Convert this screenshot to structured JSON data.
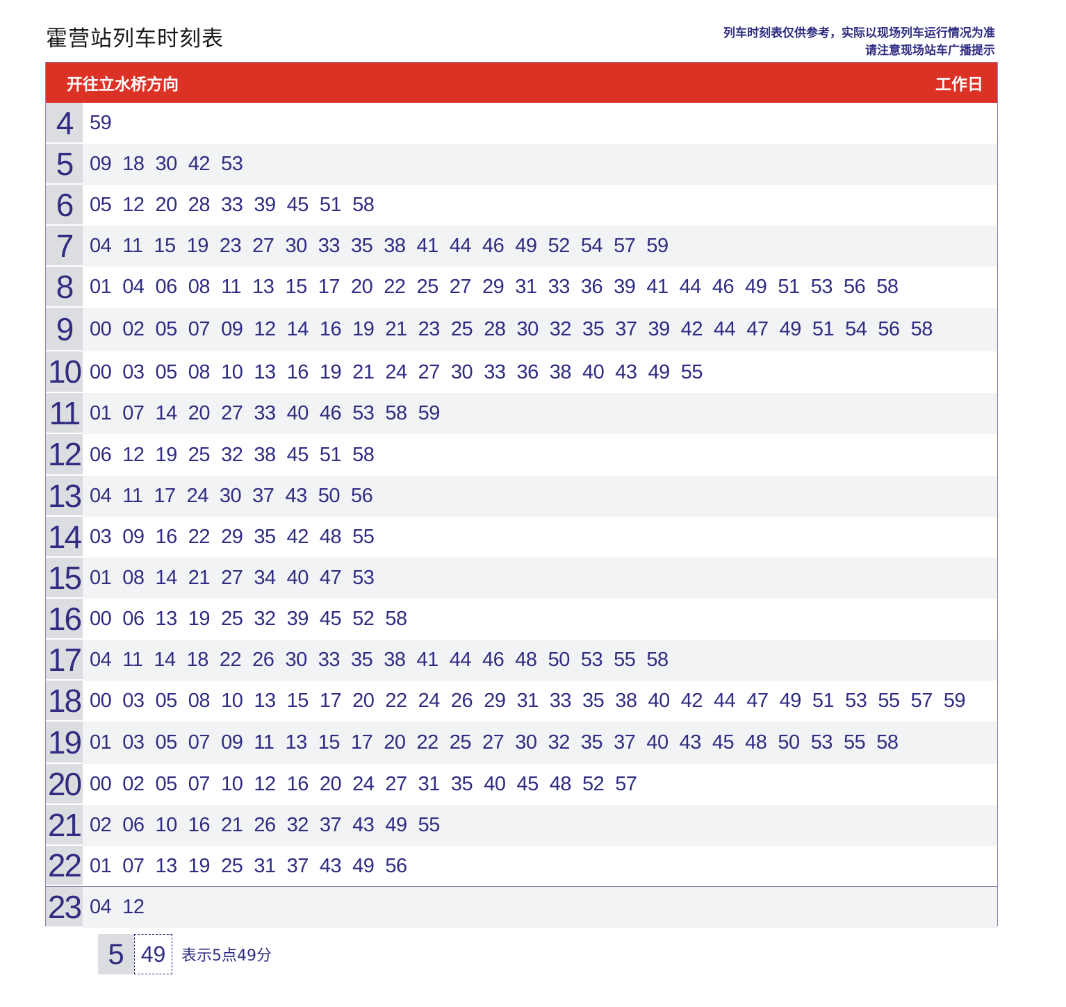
{
  "title": "霍营站列车时刻表",
  "notice": {
    "line1": "列车时刻表仅供参考，实际以现场列车运行情况为准",
    "line2": "请注意现场站车广播提示"
  },
  "header": {
    "direction": "开往立水桥方向",
    "day_type": "工作日"
  },
  "schedule": [
    {
      "hour": "4",
      "minutes": [
        "59"
      ]
    },
    {
      "hour": "5",
      "minutes": [
        "09",
        "18",
        "30",
        "42",
        "53"
      ]
    },
    {
      "hour": "6",
      "minutes": [
        "05",
        "12",
        "20",
        "28",
        "33",
        "39",
        "45",
        "51",
        "58"
      ]
    },
    {
      "hour": "7",
      "minutes": [
        "04",
        "11",
        "15",
        "19",
        "23",
        "27",
        "30",
        "33",
        "35",
        "38",
        "41",
        "44",
        "46",
        "49",
        "52",
        "54",
        "57",
        "59"
      ]
    },
    {
      "hour": "8",
      "minutes": [
        "01",
        "04",
        "06",
        "08",
        "11",
        "13",
        "15",
        "17",
        "20",
        "22",
        "25",
        "27",
        "29",
        "31",
        "33",
        "36",
        "39",
        "41",
        "44",
        "46",
        "49",
        "51",
        "53",
        "56",
        "58"
      ]
    },
    {
      "hour": "9",
      "minutes": [
        "00",
        "02",
        "05",
        "07",
        "09",
        "12",
        "14",
        "16",
        "19",
        "21",
        "23",
        "25",
        "28",
        "30",
        "32",
        "35",
        "37",
        "39",
        "42",
        "44",
        "47",
        "49",
        "51",
        "54",
        "56",
        "58"
      ]
    },
    {
      "hour": "10",
      "minutes": [
        "00",
        "03",
        "05",
        "08",
        "10",
        "13",
        "16",
        "19",
        "21",
        "24",
        "27",
        "30",
        "33",
        "36",
        "38",
        "40",
        "43",
        "49",
        "55"
      ]
    },
    {
      "hour": "11",
      "minutes": [
        "01",
        "07",
        "14",
        "20",
        "27",
        "33",
        "40",
        "46",
        "53",
        "58",
        "59"
      ]
    },
    {
      "hour": "12",
      "minutes": [
        "06",
        "12",
        "19",
        "25",
        "32",
        "38",
        "45",
        "51",
        "58"
      ]
    },
    {
      "hour": "13",
      "minutes": [
        "04",
        "11",
        "17",
        "24",
        "30",
        "37",
        "43",
        "50",
        "56"
      ]
    },
    {
      "hour": "14",
      "minutes": [
        "03",
        "09",
        "16",
        "22",
        "29",
        "35",
        "42",
        "48",
        "55"
      ]
    },
    {
      "hour": "15",
      "minutes": [
        "01",
        "08",
        "14",
        "21",
        "27",
        "34",
        "40",
        "47",
        "53"
      ]
    },
    {
      "hour": "16",
      "minutes": [
        "00",
        "06",
        "13",
        "19",
        "25",
        "32",
        "39",
        "45",
        "52",
        "58"
      ]
    },
    {
      "hour": "17",
      "minutes": [
        "04",
        "11",
        "14",
        "18",
        "22",
        "26",
        "30",
        "33",
        "35",
        "38",
        "41",
        "44",
        "46",
        "48",
        "50",
        "53",
        "55",
        "58"
      ]
    },
    {
      "hour": "18",
      "minutes": [
        "00",
        "03",
        "05",
        "08",
        "10",
        "13",
        "15",
        "17",
        "20",
        "22",
        "24",
        "26",
        "29",
        "31",
        "33",
        "35",
        "38",
        "40",
        "42",
        "44",
        "47",
        "49",
        "51",
        "53",
        "55",
        "57",
        "59"
      ]
    },
    {
      "hour": "19",
      "minutes": [
        "01",
        "03",
        "05",
        "07",
        "09",
        "11",
        "13",
        "15",
        "17",
        "20",
        "22",
        "25",
        "27",
        "30",
        "32",
        "35",
        "37",
        "40",
        "43",
        "45",
        "48",
        "50",
        "53",
        "55",
        "58"
      ]
    },
    {
      "hour": "20",
      "minutes": [
        "00",
        "02",
        "05",
        "07",
        "10",
        "12",
        "16",
        "20",
        "24",
        "27",
        "31",
        "35",
        "40",
        "45",
        "48",
        "52",
        "57"
      ]
    },
    {
      "hour": "21",
      "minutes": [
        "02",
        "06",
        "10",
        "16",
        "21",
        "26",
        "32",
        "37",
        "43",
        "49",
        "55"
      ]
    },
    {
      "hour": "22",
      "minutes": [
        "01",
        "07",
        "13",
        "19",
        "25",
        "31",
        "37",
        "43",
        "49",
        "56"
      ]
    },
    {
      "hour": "23",
      "minutes": [
        "04",
        "12"
      ]
    }
  ],
  "legend": {
    "hour": "5",
    "minute": "49",
    "text": "表示5点49分"
  }
}
